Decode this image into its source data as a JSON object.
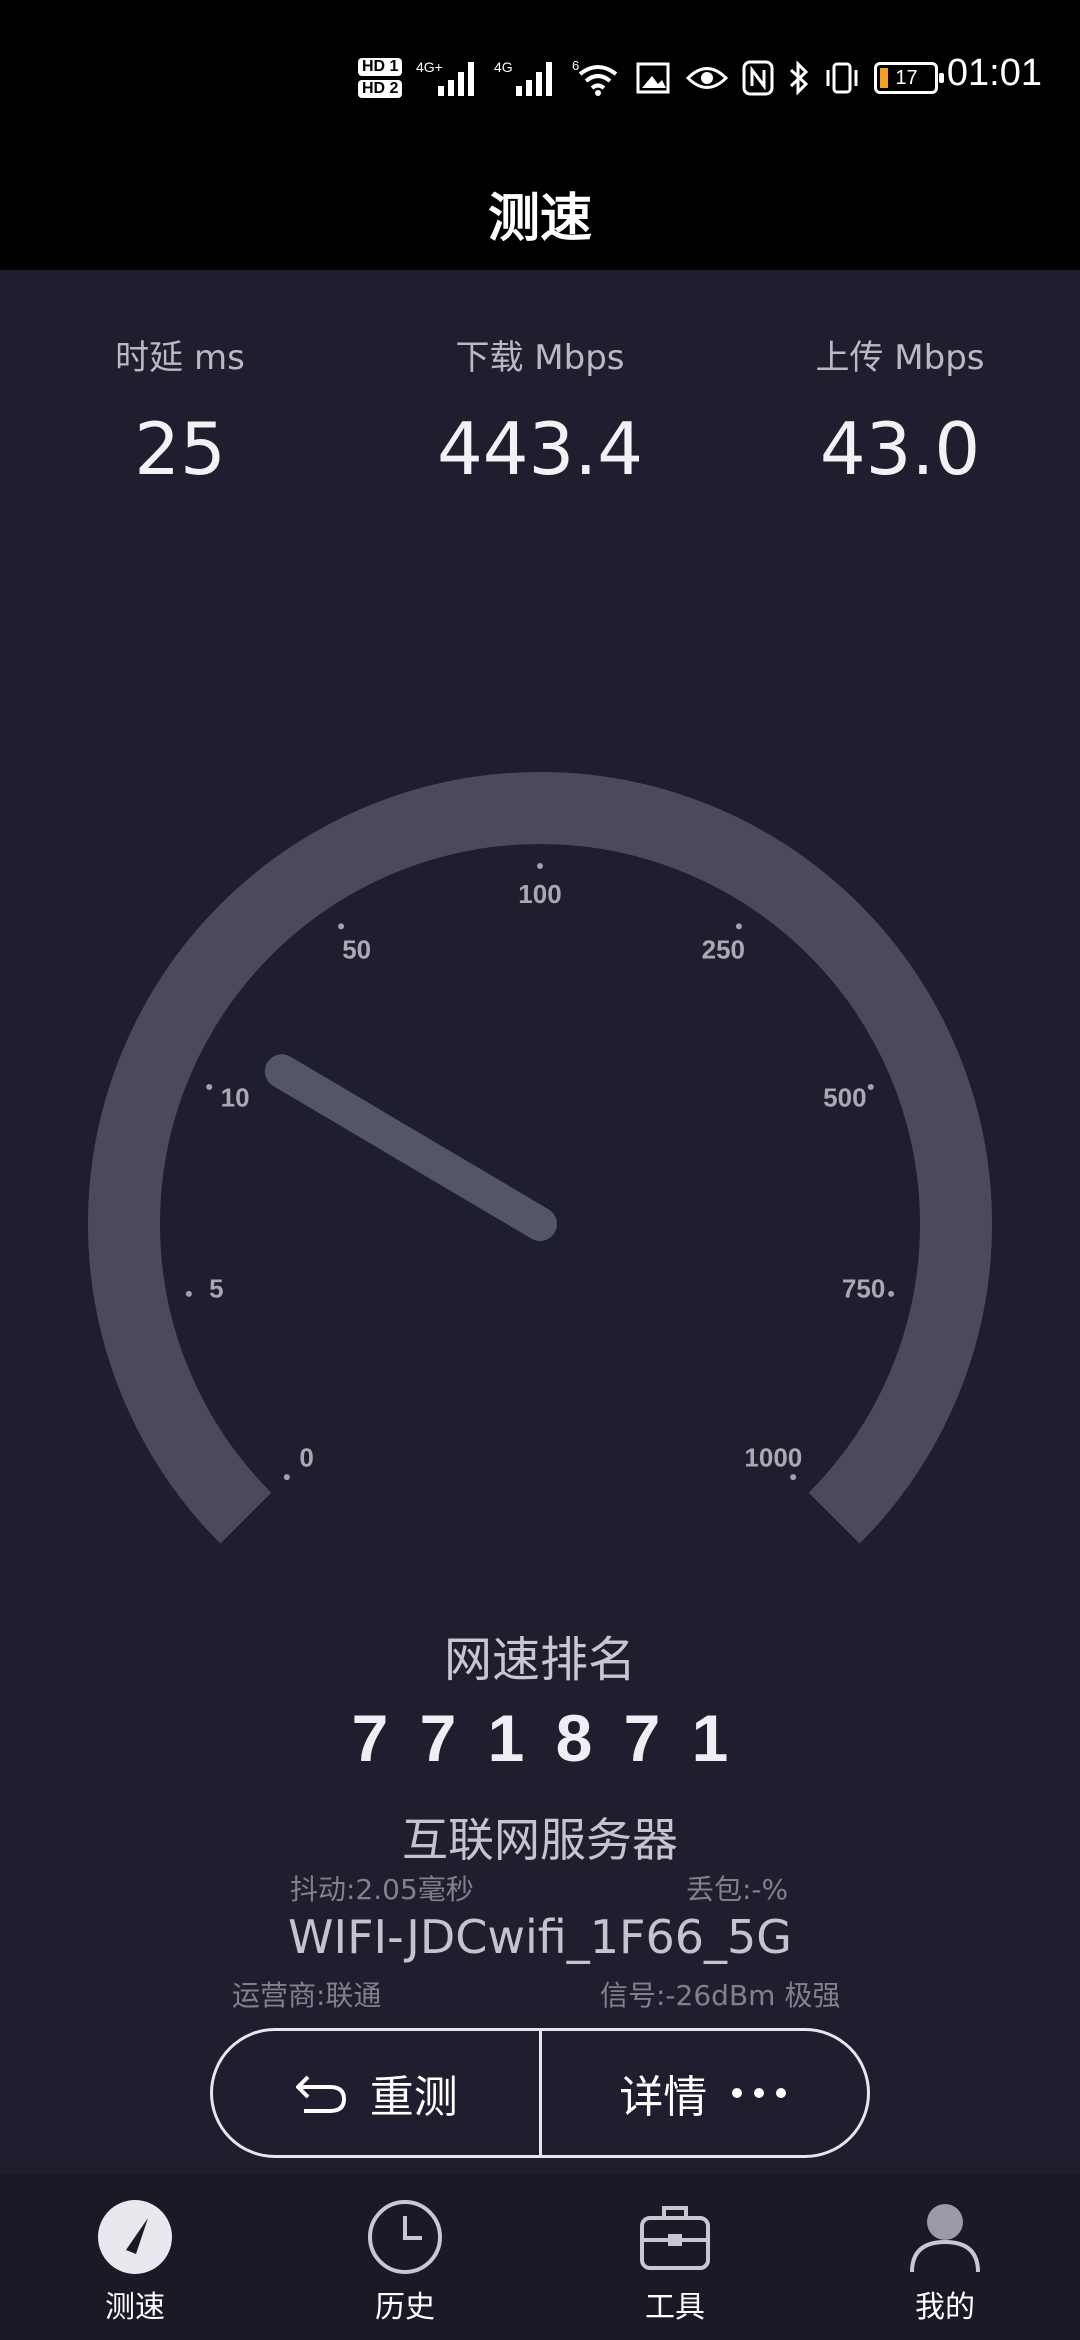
{
  "status_bar": {
    "time": "01:01",
    "hd1": "HD 1",
    "hd2": "HD 2",
    "sim1_network": "4G+",
    "sim2_network": "4G",
    "wifi_badge": "6",
    "battery": "17",
    "icons": [
      "hd-icon",
      "signal-icon",
      "signal-icon",
      "wifi-icon",
      "image-alert-icon",
      "eye-icon",
      "nfc-icon",
      "bluetooth-icon",
      "vibrate-icon",
      "battery-icon"
    ]
  },
  "header": {
    "title": "测速"
  },
  "metrics": [
    {
      "label": "时延 ms",
      "value": "25"
    },
    {
      "label": "下载 Mbps",
      "value": "443.4"
    },
    {
      "label": "上传 Mbps",
      "value": "43.0"
    }
  ],
  "gauge": {
    "scale_labels": [
      "0",
      "5",
      "10",
      "50",
      "100",
      "250",
      "500",
      "750",
      "1000"
    ],
    "needle_position": 0.28,
    "arc_color": "#4a4a5c",
    "needle_color": "#555568"
  },
  "rank": {
    "title": "网速排名",
    "digits": [
      "7",
      "7",
      "1",
      "8",
      "7",
      "1"
    ]
  },
  "server": {
    "name": "互联网服务器",
    "jitter": "抖动:2.05毫秒",
    "packet_loss": "丢包:-%",
    "wifi_name": "WIFI-JDCwifi_1F66_5G",
    "carrier": "运营商:联通",
    "signal": "信号:-26dBm 极强"
  },
  "buttons": {
    "retest": "重测",
    "details": "详情"
  },
  "nav": {
    "items": [
      {
        "label": "测速",
        "icon": "speedometer-icon"
      },
      {
        "label": "历史",
        "icon": "clock-icon"
      },
      {
        "label": "工具",
        "icon": "toolbox-icon"
      },
      {
        "label": "我的",
        "icon": "user-icon"
      }
    ]
  }
}
